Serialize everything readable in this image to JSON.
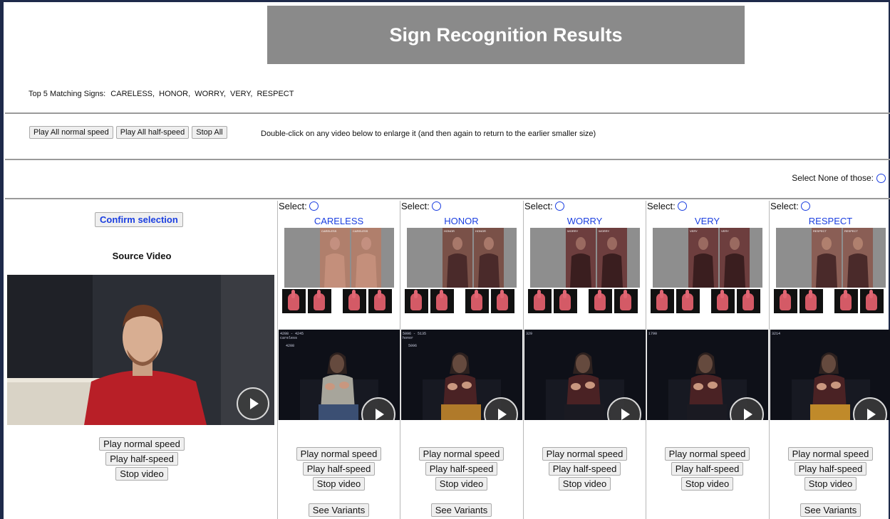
{
  "title": "Sign Recognition Results",
  "top5": {
    "label": "Top 5 Matching Signs:",
    "signs": "CARELESS,  HONOR,  WORRY,  VERY,  RESPECT"
  },
  "controls": {
    "play_all_normal": "Play All normal speed",
    "play_all_half": "Play All half-speed",
    "stop_all": "Stop All",
    "hint": "Double-click on any video below to enlarge it (and then again to return to the earlier smaller size)"
  },
  "select_none_label": "Select None of those:",
  "confirm_label": "Confirm selection",
  "source": {
    "label": "Source Video",
    "play_normal": "Play normal speed",
    "play_half": "Play half-speed",
    "stop": "Stop video"
  },
  "columns": [
    {
      "select_label": "Select:",
      "word": "CARELESS",
      "tag": "CARELESS",
      "overlay_line1": "4208 - 4245",
      "overlay_line2": "careless",
      "overlay_line3": "4208",
      "play_normal": "Play normal speed",
      "play_half": "Play half-speed",
      "stop": "Stop video",
      "variants": "See Variants"
    },
    {
      "select_label": "Select:",
      "word": "HONOR",
      "tag": "HONOR",
      "overlay_line1": "5096 - 5135",
      "overlay_line2": "honor",
      "overlay_line3": "5096",
      "play_normal": "Play normal speed",
      "play_half": "Play half-speed",
      "stop": "Stop video",
      "variants": "See Variants"
    },
    {
      "select_label": "Select:",
      "word": "WORRY",
      "tag": "WORRY",
      "overlay_line1": "329",
      "overlay_line2": "",
      "overlay_line3": "",
      "play_normal": "Play normal speed",
      "play_half": "Play half-speed",
      "stop": "Stop video",
      "variants": ""
    },
    {
      "select_label": "Select:",
      "word": "VERY",
      "tag": "VERY",
      "overlay_line1": "1790",
      "overlay_line2": "",
      "overlay_line3": "",
      "play_normal": "Play normal speed",
      "play_half": "Play half-speed",
      "stop": "Stop video",
      "variants": ""
    },
    {
      "select_label": "Select:",
      "word": "RESPECT",
      "tag": "RESPECT",
      "overlay_line1": "3214",
      "overlay_line2": "",
      "overlay_line3": "",
      "play_normal": "Play normal speed",
      "play_half": "Play half-speed",
      "stop": "Stop video",
      "variants": "See Variants"
    }
  ],
  "colors": {
    "accent": "#1a3ee0",
    "title_bg": "#8a8a8a",
    "frame": "#1e2a4a"
  }
}
